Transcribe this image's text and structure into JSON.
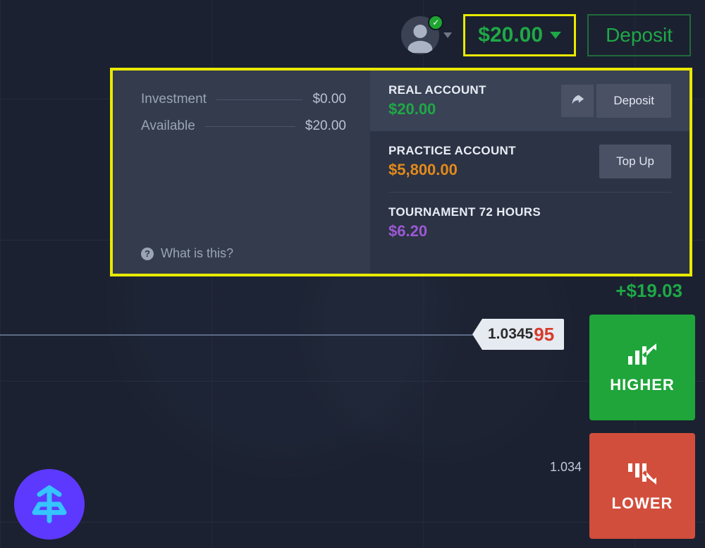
{
  "header": {
    "balance": "$20.00",
    "deposit_label": "Deposit"
  },
  "panel": {
    "investment_label": "Investment",
    "investment_value": "$0.00",
    "available_label": "Available",
    "available_value": "$20.00",
    "what_is_this": "What is this?"
  },
  "accounts": {
    "real": {
      "name": "REAL ACCOUNT",
      "amount": "$20.00",
      "action": "Deposit"
    },
    "practice": {
      "name": "PRACTICE ACCOUNT",
      "amount": "$5,800.00",
      "action": "Top Up"
    },
    "tournament": {
      "name": "TOURNAMENT 72 HOURS",
      "amount": "$6.20"
    }
  },
  "pnl": "+$19.03",
  "price_marker": {
    "major": "1.0345",
    "minor": "95"
  },
  "tick_value": "1.034",
  "trade": {
    "higher": "HIGHER",
    "lower": "LOWER"
  }
}
